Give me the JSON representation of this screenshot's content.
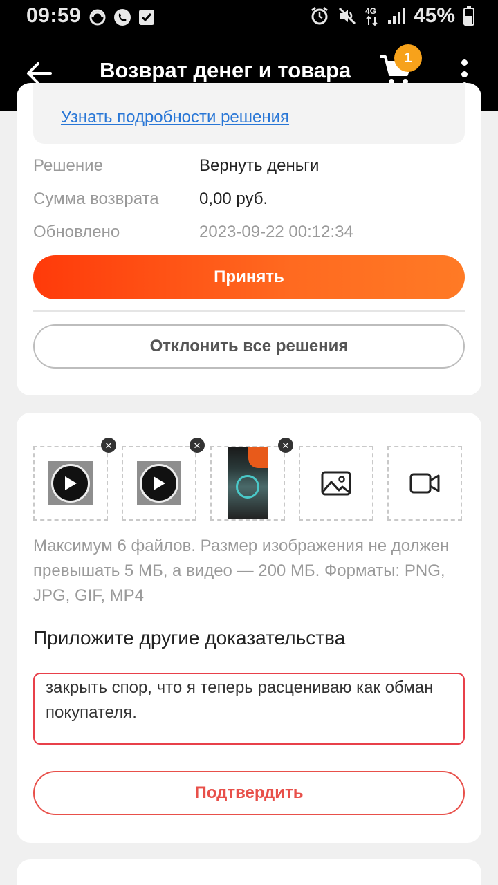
{
  "status_bar": {
    "time": "09:59",
    "battery": "45%",
    "network": "4G"
  },
  "app_bar": {
    "title": "Возврат денег и товара",
    "cart_count": "1"
  },
  "decision": {
    "details_link": "Узнать подробности решения",
    "rows": [
      {
        "label": "Решение",
        "value": "Вернуть деньги"
      },
      {
        "label": "Сумма возврата",
        "value": "0,00 руб."
      },
      {
        "label": "Обновлено",
        "value": "2023-09-22 00:12:34"
      }
    ],
    "accept_label": "Принять",
    "reject_label": "Отклонить все решения"
  },
  "evidence": {
    "hint": "Максимум 6 файлов. Размер изображения не должен превышать 5 МБ, а видео — 200 МБ. Форматы: PNG, JPG, GIF, MP4",
    "title": "Приложите другие доказательства",
    "text": "не предлагал взамен неоднократно просил меня закрыть спор, что я теперь расцениваю как обман покупателя.",
    "confirm_label": "Подтвердить"
  },
  "colors": {
    "accent": "#ff4a12",
    "link": "#2876d6",
    "badge": "#f7a21b",
    "error_border": "#e8404a"
  }
}
